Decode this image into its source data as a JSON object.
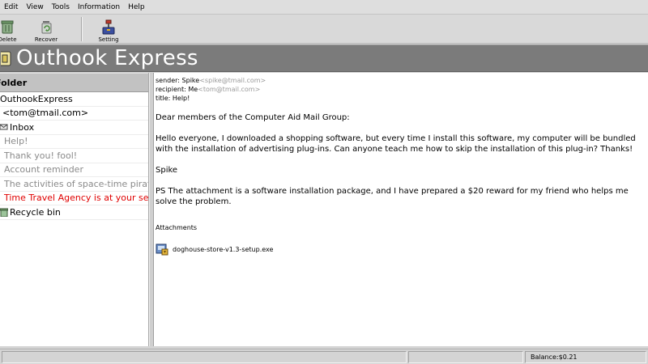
{
  "menu": [
    "Edit",
    "View",
    "Tools",
    "Information",
    "Help"
  ],
  "toolbar": {
    "delete_label": "Delete",
    "recover_label": "Recover",
    "setting_label": "Setting"
  },
  "app": {
    "title": "Outhook Express",
    "colors": {
      "banner": "#7b7b7b",
      "selected_text": "#e00000",
      "muted_text": "#8a8a8a"
    }
  },
  "folders": {
    "header": "Folder",
    "root": "OuthookExpress",
    "account": "<tom@tmail.com>",
    "inbox": "Inbox",
    "messages": [
      "Help!",
      "Thank you! fool!",
      "Account reminder",
      "The activities of space-time pirate",
      "Time Travel Agency is at your service"
    ],
    "recycle": "Recycle bin"
  },
  "message": {
    "sender_label": "sender: ",
    "sender_name": "Spike",
    "sender_addr": "<spike@tmail.com>",
    "recipient_label": "recipient: ",
    "recipient_name": "Me",
    "recipient_addr": "<tom@tmail.com>",
    "title_label": "title: ",
    "title": "Help!",
    "greeting": "Dear members of the Computer Aid Mail Group:",
    "para1": "Hello everyone, I downloaded a shopping software, but every time I install this software, my computer will be bundled with the installation of advertising plug-ins. Can anyone teach me how to skip the installation of this plug-in? Thanks!",
    "signature": "Spike",
    "ps": "PS The attachment is a software installation package, and I have prepared a $20 reward for my friend who helps me solve the problem.",
    "attachments_label": "Attachments",
    "attachment_file": "doghouse-store-v1.3-setup.exe"
  },
  "status": {
    "balance": "Balance:$0.21"
  }
}
